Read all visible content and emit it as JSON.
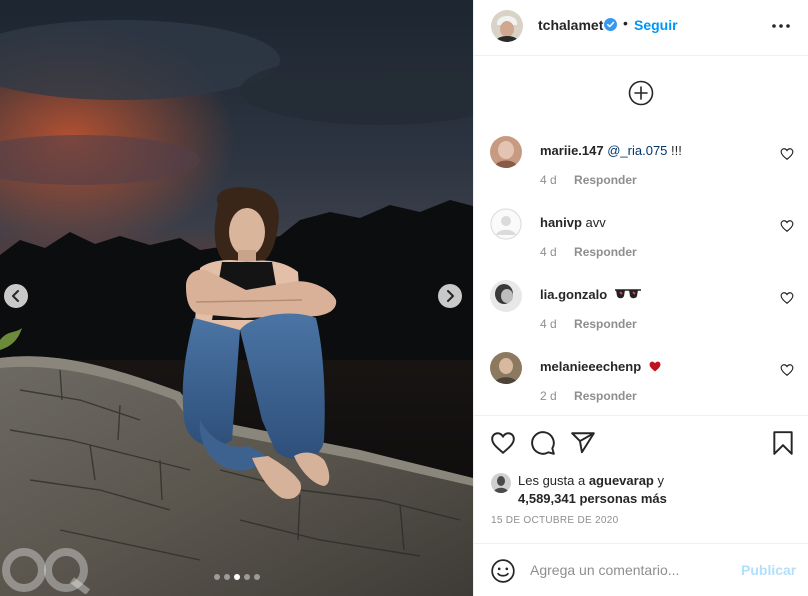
{
  "carousel": {
    "prev_icon": "chevron-left-icon",
    "next_icon": "chevron-right-icon",
    "slide_count": 5,
    "active_slide": 3
  },
  "post": {
    "author": {
      "username": "tchalamet",
      "verified": true,
      "verified_icon": "verified-badge-icon",
      "separator": "•",
      "follow_label": "Seguir"
    },
    "more_icon": "more-options-icon",
    "load_more_icon": "plus-circle-icon"
  },
  "comments": [
    {
      "username": "mariie.147",
      "mention": "@_ria.075",
      "text": " !!!",
      "time": "4 d",
      "reply_label": "Responder",
      "avatar_color": "#b07a62"
    },
    {
      "username": "hanivp",
      "mention": "",
      "text": "avv",
      "time": "4 d",
      "reply_label": "Responder",
      "avatar_color": "#dbdbdb"
    },
    {
      "username": "lia.gonzalo",
      "mention": "",
      "text": "",
      "time": "4 d",
      "reply_label": "Responder",
      "avatar_color": "#9a9a9a"
    },
    {
      "username": "melanieeechenp",
      "mention": "",
      "text": "",
      "time": "2 d",
      "reply_label": "Responder",
      "avatar_color": "#7a6a55"
    }
  ],
  "actions": {
    "like_icon": "heart-icon",
    "comment_icon": "comment-icon",
    "share_icon": "paper-plane-icon",
    "save_icon": "bookmark-icon"
  },
  "likes": {
    "prefix": "Les gusta a ",
    "user": "aguevarap",
    "middle": " y",
    "others": "4,589,341 personas más"
  },
  "date": "15 DE OCTUBRE DE 2020",
  "composer": {
    "emoji_icon": "smiley-icon",
    "placeholder": "Agrega un comentario...",
    "publish_label": "Publicar"
  },
  "colors": {
    "link_blue": "#0095f6",
    "publish_disabled": "#b2dffc",
    "mention": "#00376b",
    "muted": "#8e8e8e",
    "heart_red": "#ed4956"
  }
}
